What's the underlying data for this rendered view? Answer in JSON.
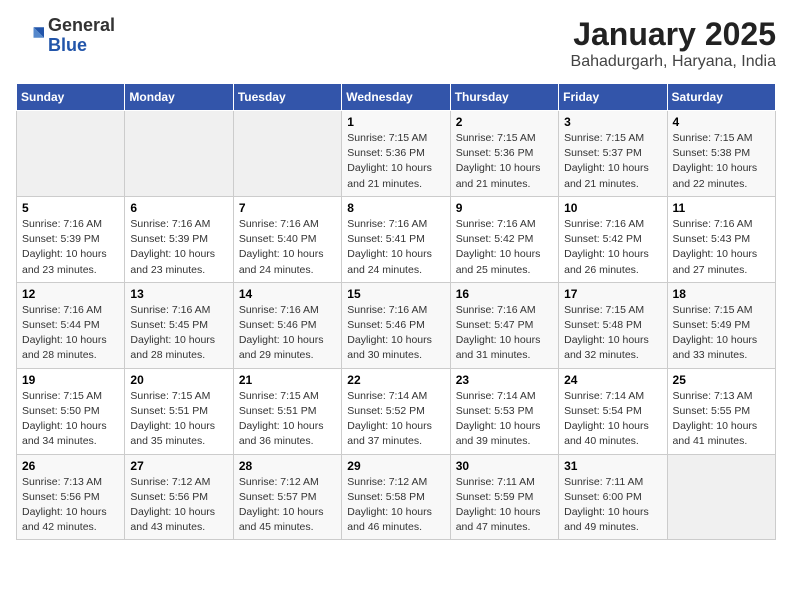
{
  "logo": {
    "general": "General",
    "blue": "Blue"
  },
  "header": {
    "month": "January 2025",
    "location": "Bahadurgarh, Haryana, India"
  },
  "weekdays": [
    "Sunday",
    "Monday",
    "Tuesday",
    "Wednesday",
    "Thursday",
    "Friday",
    "Saturday"
  ],
  "weeks": [
    [
      {
        "day": "",
        "info": ""
      },
      {
        "day": "",
        "info": ""
      },
      {
        "day": "",
        "info": ""
      },
      {
        "day": "1",
        "info": "Sunrise: 7:15 AM\nSunset: 5:36 PM\nDaylight: 10 hours\nand 21 minutes."
      },
      {
        "day": "2",
        "info": "Sunrise: 7:15 AM\nSunset: 5:36 PM\nDaylight: 10 hours\nand 21 minutes."
      },
      {
        "day": "3",
        "info": "Sunrise: 7:15 AM\nSunset: 5:37 PM\nDaylight: 10 hours\nand 21 minutes."
      },
      {
        "day": "4",
        "info": "Sunrise: 7:15 AM\nSunset: 5:38 PM\nDaylight: 10 hours\nand 22 minutes."
      }
    ],
    [
      {
        "day": "5",
        "info": "Sunrise: 7:16 AM\nSunset: 5:39 PM\nDaylight: 10 hours\nand 23 minutes."
      },
      {
        "day": "6",
        "info": "Sunrise: 7:16 AM\nSunset: 5:39 PM\nDaylight: 10 hours\nand 23 minutes."
      },
      {
        "day": "7",
        "info": "Sunrise: 7:16 AM\nSunset: 5:40 PM\nDaylight: 10 hours\nand 24 minutes."
      },
      {
        "day": "8",
        "info": "Sunrise: 7:16 AM\nSunset: 5:41 PM\nDaylight: 10 hours\nand 24 minutes."
      },
      {
        "day": "9",
        "info": "Sunrise: 7:16 AM\nSunset: 5:42 PM\nDaylight: 10 hours\nand 25 minutes."
      },
      {
        "day": "10",
        "info": "Sunrise: 7:16 AM\nSunset: 5:42 PM\nDaylight: 10 hours\nand 26 minutes."
      },
      {
        "day": "11",
        "info": "Sunrise: 7:16 AM\nSunset: 5:43 PM\nDaylight: 10 hours\nand 27 minutes."
      }
    ],
    [
      {
        "day": "12",
        "info": "Sunrise: 7:16 AM\nSunset: 5:44 PM\nDaylight: 10 hours\nand 28 minutes."
      },
      {
        "day": "13",
        "info": "Sunrise: 7:16 AM\nSunset: 5:45 PM\nDaylight: 10 hours\nand 28 minutes."
      },
      {
        "day": "14",
        "info": "Sunrise: 7:16 AM\nSunset: 5:46 PM\nDaylight: 10 hours\nand 29 minutes."
      },
      {
        "day": "15",
        "info": "Sunrise: 7:16 AM\nSunset: 5:46 PM\nDaylight: 10 hours\nand 30 minutes."
      },
      {
        "day": "16",
        "info": "Sunrise: 7:16 AM\nSunset: 5:47 PM\nDaylight: 10 hours\nand 31 minutes."
      },
      {
        "day": "17",
        "info": "Sunrise: 7:15 AM\nSunset: 5:48 PM\nDaylight: 10 hours\nand 32 minutes."
      },
      {
        "day": "18",
        "info": "Sunrise: 7:15 AM\nSunset: 5:49 PM\nDaylight: 10 hours\nand 33 minutes."
      }
    ],
    [
      {
        "day": "19",
        "info": "Sunrise: 7:15 AM\nSunset: 5:50 PM\nDaylight: 10 hours\nand 34 minutes."
      },
      {
        "day": "20",
        "info": "Sunrise: 7:15 AM\nSunset: 5:51 PM\nDaylight: 10 hours\nand 35 minutes."
      },
      {
        "day": "21",
        "info": "Sunrise: 7:15 AM\nSunset: 5:51 PM\nDaylight: 10 hours\nand 36 minutes."
      },
      {
        "day": "22",
        "info": "Sunrise: 7:14 AM\nSunset: 5:52 PM\nDaylight: 10 hours\nand 37 minutes."
      },
      {
        "day": "23",
        "info": "Sunrise: 7:14 AM\nSunset: 5:53 PM\nDaylight: 10 hours\nand 39 minutes."
      },
      {
        "day": "24",
        "info": "Sunrise: 7:14 AM\nSunset: 5:54 PM\nDaylight: 10 hours\nand 40 minutes."
      },
      {
        "day": "25",
        "info": "Sunrise: 7:13 AM\nSunset: 5:55 PM\nDaylight: 10 hours\nand 41 minutes."
      }
    ],
    [
      {
        "day": "26",
        "info": "Sunrise: 7:13 AM\nSunset: 5:56 PM\nDaylight: 10 hours\nand 42 minutes."
      },
      {
        "day": "27",
        "info": "Sunrise: 7:12 AM\nSunset: 5:56 PM\nDaylight: 10 hours\nand 43 minutes."
      },
      {
        "day": "28",
        "info": "Sunrise: 7:12 AM\nSunset: 5:57 PM\nDaylight: 10 hours\nand 45 minutes."
      },
      {
        "day": "29",
        "info": "Sunrise: 7:12 AM\nSunset: 5:58 PM\nDaylight: 10 hours\nand 46 minutes."
      },
      {
        "day": "30",
        "info": "Sunrise: 7:11 AM\nSunset: 5:59 PM\nDaylight: 10 hours\nand 47 minutes."
      },
      {
        "day": "31",
        "info": "Sunrise: 7:11 AM\nSunset: 6:00 PM\nDaylight: 10 hours\nand 49 minutes."
      },
      {
        "day": "",
        "info": ""
      }
    ]
  ]
}
